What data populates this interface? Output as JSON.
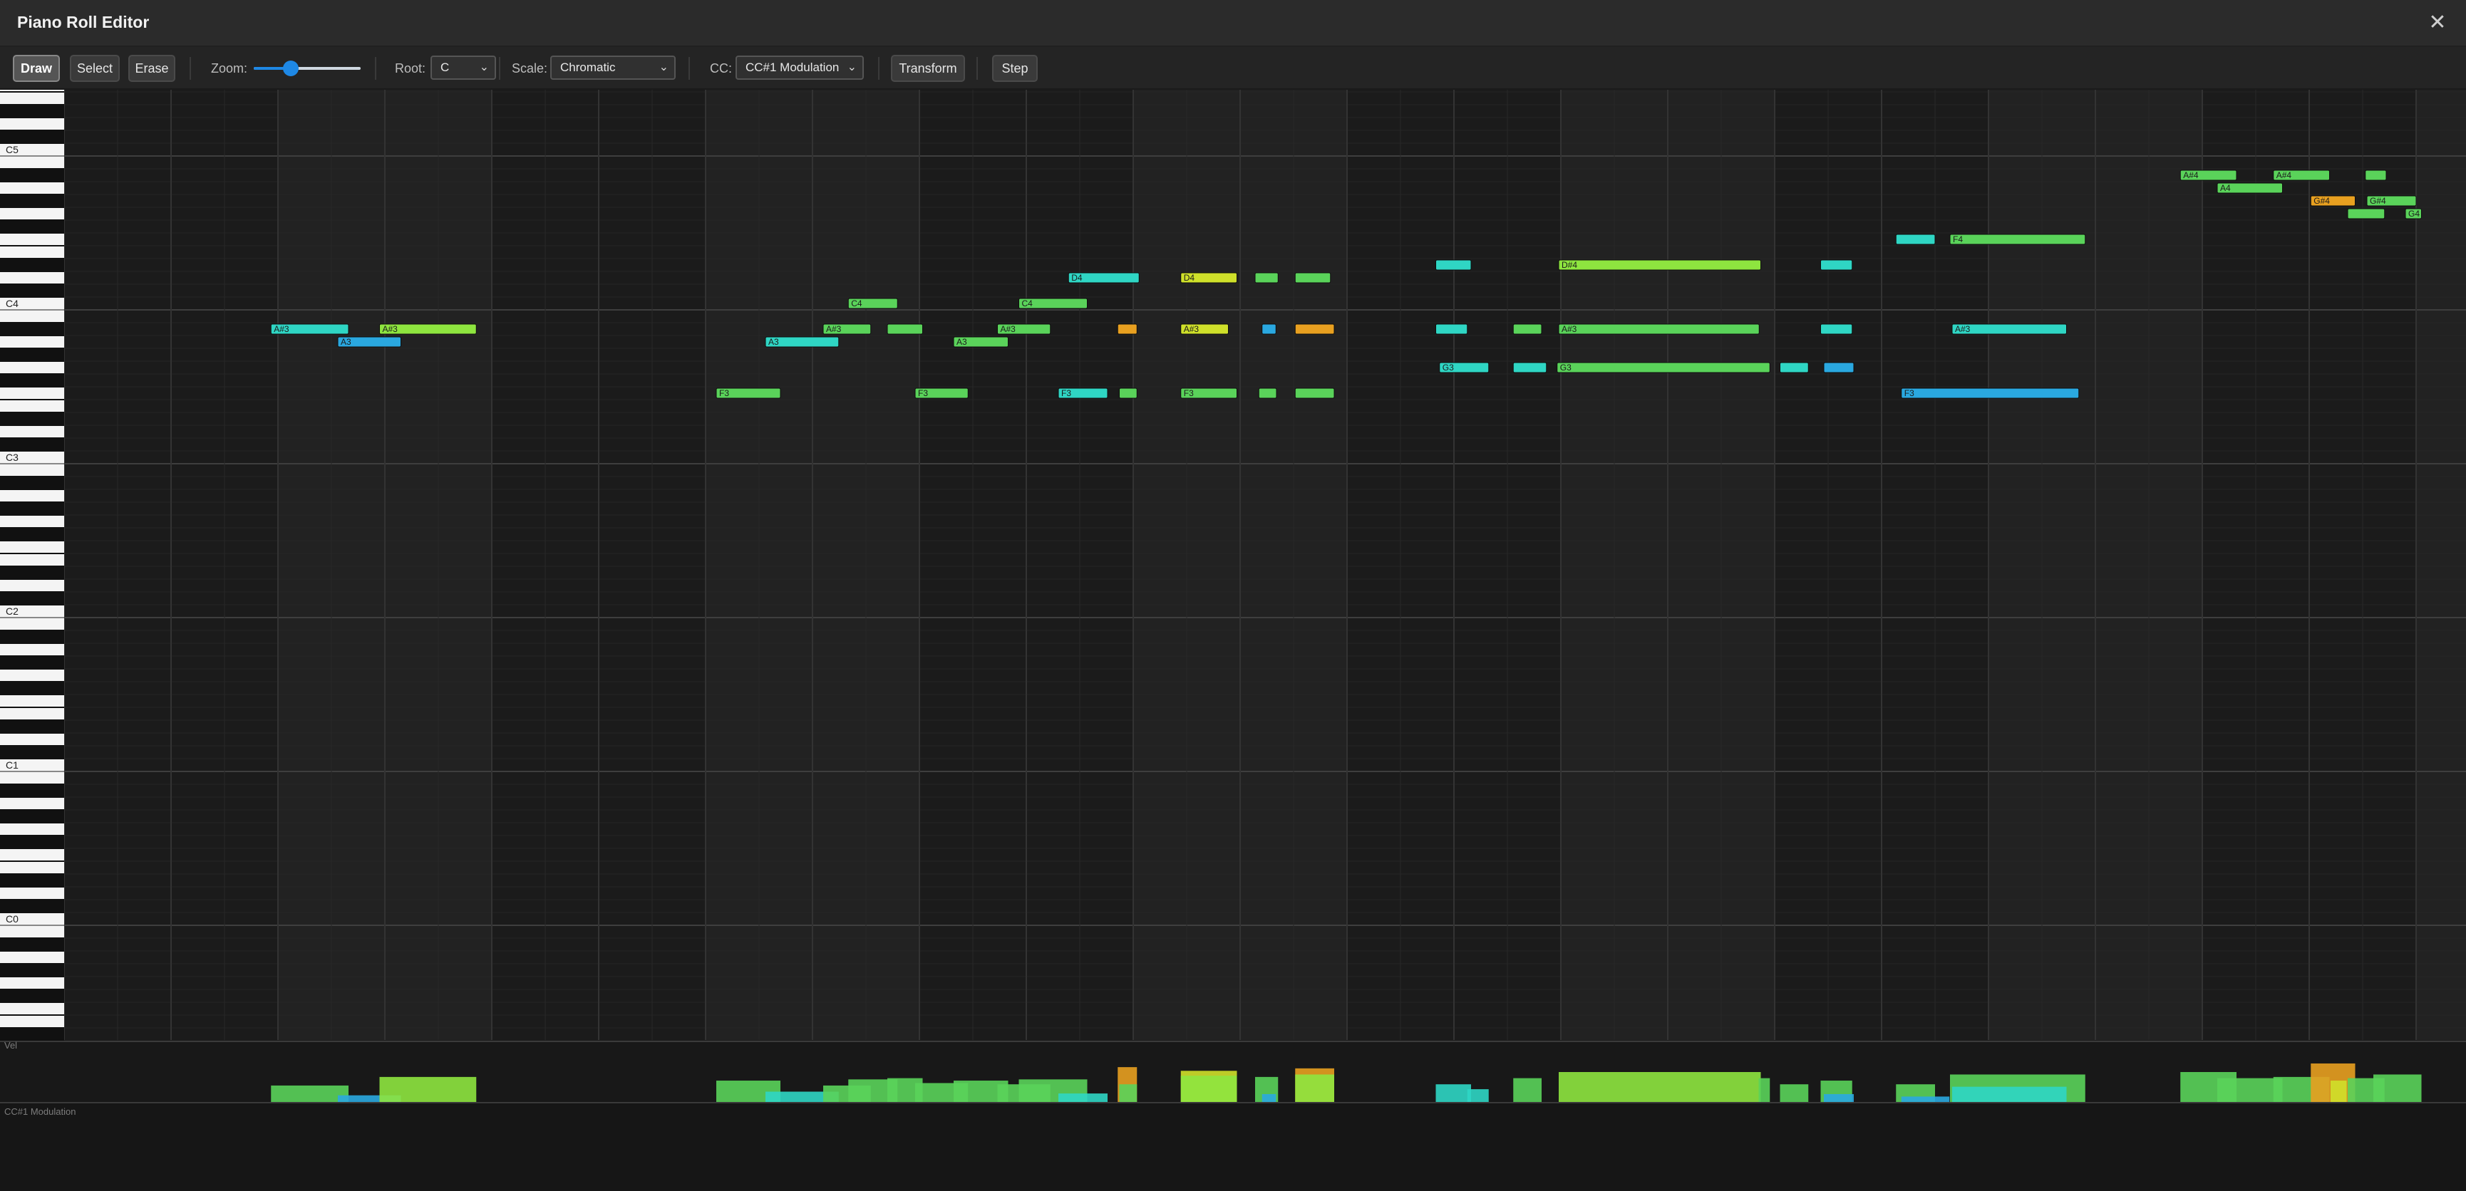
{
  "window": {
    "title": "Piano Roll Editor",
    "close_glyph": "✕"
  },
  "toolbar": {
    "draw_label": "Draw",
    "select_label": "Select",
    "erase_label": "Erase",
    "zoom_label": "Zoom:",
    "zoom_level": 0.35,
    "root_label": "Root:",
    "root_value": "C",
    "scale_label": "Scale:",
    "scale_value": "Chromatic",
    "cc_label": "CC:",
    "cc_value": "CC#1 Modulation",
    "transform_label": "Transform",
    "step_label": "Step"
  },
  "keyboard": {
    "octave_labels": [
      "C5",
      "C4",
      "C3",
      "C2",
      "C1",
      "C0"
    ]
  },
  "lanes": {
    "velocity_label": "Vel",
    "cc_label": "CC#1 Modulation"
  },
  "colors": {
    "green": "#5ad35a",
    "lime": "#8ee53f",
    "yellow": "#cfe02a",
    "orange": "#e8a020",
    "cyan": "#2fd6c4",
    "blue": "#2aa8e0"
  },
  "notes": [
    {
      "name": "A#3",
      "b": 3.87,
      "d": 1.45,
      "c": "cyan",
      "label": "A#3"
    },
    {
      "name": "A3",
      "b": 5.12,
      "d": 1.18,
      "c": "blue",
      "label": "A3"
    },
    {
      "name": "A#3",
      "b": 5.9,
      "d": 1.81,
      "c": "lime",
      "label": "A#3"
    },
    {
      "name": "F3",
      "b": 12.2,
      "d": 1.2,
      "c": "green",
      "label": "F3"
    },
    {
      "name": "A3",
      "b": 13.12,
      "d": 1.37,
      "c": "cyan",
      "label": "A3"
    },
    {
      "name": "A#3",
      "b": 14.2,
      "d": 0.89,
      "c": "green",
      "label": "A#3"
    },
    {
      "name": "C4",
      "b": 14.67,
      "d": 0.92,
      "c": "green",
      "label": "C4"
    },
    {
      "name": "A#3",
      "b": 15.4,
      "d": 0.66,
      "c": "green",
      "label": ""
    },
    {
      "name": "F3",
      "b": 15.92,
      "d": 0.99,
      "c": "green",
      "label": "F3"
    },
    {
      "name": "A3",
      "b": 16.64,
      "d": 1.02,
      "c": "green",
      "label": "A3"
    },
    {
      "name": "A#3",
      "b": 17.46,
      "d": 0.99,
      "c": "green",
      "label": "A#3"
    },
    {
      "name": "C4",
      "b": 17.86,
      "d": 1.28,
      "c": "green",
      "label": "C4"
    },
    {
      "name": "F3",
      "b": 18.6,
      "d": 0.92,
      "c": "cyan",
      "label": "F3"
    },
    {
      "name": "D4",
      "b": 18.79,
      "d": 1.32,
      "c": "cyan",
      "label": "D4"
    },
    {
      "name": "A#3",
      "b": 19.71,
      "d": 0.36,
      "c": "orange",
      "label": ""
    },
    {
      "name": "F3",
      "b": 19.74,
      "d": 0.33,
      "c": "green",
      "label": ""
    },
    {
      "name": "D4",
      "b": 20.89,
      "d": 1.05,
      "c": "yellow",
      "label": "D4"
    },
    {
      "name": "A#3",
      "b": 20.89,
      "d": 0.89,
      "c": "yellow",
      "label": "A#3"
    },
    {
      "name": "F3",
      "b": 20.89,
      "d": 1.05,
      "c": "green",
      "label": "F3"
    },
    {
      "name": "D4",
      "b": 22.28,
      "d": 0.43,
      "c": "green",
      "label": ""
    },
    {
      "name": "A#3",
      "b": 22.41,
      "d": 0.26,
      "c": "blue",
      "label": ""
    },
    {
      "name": "F3",
      "b": 22.35,
      "d": 0.33,
      "c": "green",
      "label": ""
    },
    {
      "name": "D4",
      "b": 23.03,
      "d": 0.66,
      "c": "green",
      "label": ""
    },
    {
      "name": "A#3",
      "b": 23.03,
      "d": 0.73,
      "c": "orange",
      "label": ""
    },
    {
      "name": "F3",
      "b": 23.03,
      "d": 0.73,
      "c": "green",
      "label": ""
    },
    {
      "name": "D#4",
      "b": 25.66,
      "d": 0.66,
      "c": "cyan",
      "label": ""
    },
    {
      "name": "A#3",
      "b": 25.66,
      "d": 0.59,
      "c": "cyan",
      "label": ""
    },
    {
      "name": "G3",
      "b": 25.73,
      "d": 0.92,
      "c": "cyan",
      "label": "G3"
    },
    {
      "name": "A#3",
      "b": 27.11,
      "d": 0.53,
      "c": "green",
      "label": ""
    },
    {
      "name": "G3",
      "b": 27.11,
      "d": 0.62,
      "c": "cyan",
      "label": ""
    },
    {
      "name": "D#4",
      "b": 27.96,
      "d": 3.78,
      "c": "lime",
      "label": "D#4"
    },
    {
      "name": "A#3",
      "b": 27.96,
      "d": 3.75,
      "c": "green",
      "label": "A#3"
    },
    {
      "name": "G3",
      "b": 27.93,
      "d": 3.98,
      "c": "green",
      "label": "G3"
    },
    {
      "name": "G3",
      "b": 32.1,
      "d": 0.53,
      "c": "cyan",
      "label": ""
    },
    {
      "name": "D#4",
      "b": 32.86,
      "d": 0.59,
      "c": "cyan",
      "label": ""
    },
    {
      "name": "A#3",
      "b": 32.86,
      "d": 0.59,
      "c": "cyan",
      "label": ""
    },
    {
      "name": "G3",
      "b": 32.92,
      "d": 0.56,
      "c": "blue",
      "label": ""
    },
    {
      "name": "F4",
      "b": 34.27,
      "d": 0.73,
      "c": "cyan",
      "label": ""
    },
    {
      "name": "F3",
      "b": 34.37,
      "d": 3.32,
      "c": "blue",
      "label": "F3"
    },
    {
      "name": "F4",
      "b": 35.28,
      "d": 2.53,
      "c": "green",
      "label": "F4"
    },
    {
      "name": "A#3",
      "b": 35.32,
      "d": 2.14,
      "c": "cyan",
      "label": "A#3"
    },
    {
      "name": "A#4",
      "b": 39.59,
      "d": 1.05,
      "c": "green",
      "label": "A#4"
    },
    {
      "name": "A4",
      "b": 40.28,
      "d": 1.22,
      "c": "green",
      "label": "A4"
    },
    {
      "name": "A#4",
      "b": 41.33,
      "d": 1.05,
      "c": "green",
      "label": "A#4"
    },
    {
      "name": "G#4",
      "b": 42.03,
      "d": 0.83,
      "c": "orange",
      "label": "G#4"
    },
    {
      "name": "G4",
      "b": 42.72,
      "d": 0.69,
      "c": "green",
      "label": ""
    },
    {
      "name": "A#4",
      "b": 43.05,
      "d": 0.39,
      "c": "green",
      "label": ""
    },
    {
      "name": "G#4",
      "b": 43.08,
      "d": 0.92,
      "c": "green",
      "label": "G#4"
    },
    {
      "name": "G4",
      "b": 43.8,
      "d": 0.3,
      "c": "green",
      "label": "G4"
    }
  ],
  "velocities": [
    {
      "b": 3.87,
      "d": 1.45,
      "v": 0.28,
      "c": "green"
    },
    {
      "b": 5.12,
      "d": 1.18,
      "v": 0.12,
      "c": "blue"
    },
    {
      "b": 5.9,
      "d": 1.81,
      "v": 0.42,
      "c": "lime"
    },
    {
      "b": 12.2,
      "d": 1.2,
      "v": 0.36,
      "c": "green"
    },
    {
      "b": 13.12,
      "d": 1.37,
      "v": 0.18,
      "c": "cyan"
    },
    {
      "b": 14.2,
      "d": 0.89,
      "v": 0.28,
      "c": "green"
    },
    {
      "b": 14.67,
      "d": 0.92,
      "v": 0.38,
      "c": "green"
    },
    {
      "b": 15.4,
      "d": 0.66,
      "v": 0.4,
      "c": "green"
    },
    {
      "b": 15.92,
      "d": 0.99,
      "v": 0.32,
      "c": "green"
    },
    {
      "b": 16.64,
      "d": 1.02,
      "v": 0.36,
      "c": "green"
    },
    {
      "b": 17.46,
      "d": 0.99,
      "v": 0.3,
      "c": "green"
    },
    {
      "b": 17.86,
      "d": 1.28,
      "v": 0.38,
      "c": "green"
    },
    {
      "b": 18.6,
      "d": 0.92,
      "v": 0.15,
      "c": "cyan"
    },
    {
      "b": 19.71,
      "d": 0.36,
      "v": 0.58,
      "c": "orange"
    },
    {
      "b": 19.74,
      "d": 0.33,
      "v": 0.3,
      "c": "green"
    },
    {
      "b": 20.89,
      "d": 1.05,
      "v": 0.52,
      "c": "yellow"
    },
    {
      "b": 20.89,
      "d": 1.05,
      "v": 0.44,
      "c": "lime"
    },
    {
      "b": 22.28,
      "d": 0.43,
      "v": 0.42,
      "c": "green"
    },
    {
      "b": 22.41,
      "d": 0.26,
      "v": 0.14,
      "c": "blue"
    },
    {
      "b": 23.03,
      "d": 0.73,
      "v": 0.56,
      "c": "orange"
    },
    {
      "b": 23.03,
      "d": 0.73,
      "v": 0.46,
      "c": "lime"
    },
    {
      "b": 25.66,
      "d": 0.66,
      "v": 0.3,
      "c": "cyan"
    },
    {
      "b": 26.25,
      "d": 0.4,
      "v": 0.22,
      "c": "cyan"
    },
    {
      "b": 27.11,
      "d": 0.53,
      "v": 0.4,
      "c": "green"
    },
    {
      "b": 27.96,
      "d": 3.78,
      "v": 0.5,
      "c": "lime"
    },
    {
      "b": 31.7,
      "d": 0.21,
      "v": 0.4,
      "c": "green"
    },
    {
      "b": 32.1,
      "d": 0.53,
      "v": 0.3,
      "c": "green"
    },
    {
      "b": 32.86,
      "d": 0.59,
      "v": 0.36,
      "c": "green"
    },
    {
      "b": 32.92,
      "d": 0.56,
      "v": 0.14,
      "c": "blue"
    },
    {
      "b": 34.27,
      "d": 0.73,
      "v": 0.3,
      "c": "green"
    },
    {
      "b": 34.37,
      "d": 0.9,
      "v": 0.1,
      "c": "blue"
    },
    {
      "b": 35.28,
      "d": 2.53,
      "v": 0.46,
      "c": "green"
    },
    {
      "b": 35.32,
      "d": 2.14,
      "v": 0.26,
      "c": "cyan"
    },
    {
      "b": 39.59,
      "d": 1.05,
      "v": 0.5,
      "c": "green"
    },
    {
      "b": 40.28,
      "d": 1.22,
      "v": 0.4,
      "c": "green"
    },
    {
      "b": 41.33,
      "d": 1.05,
      "v": 0.42,
      "c": "green"
    },
    {
      "b": 42.03,
      "d": 0.83,
      "v": 0.64,
      "c": "orange"
    },
    {
      "b": 42.4,
      "d": 0.3,
      "v": 0.36,
      "c": "yellow"
    },
    {
      "b": 42.72,
      "d": 0.69,
      "v": 0.4,
      "c": "green"
    },
    {
      "b": 43.2,
      "d": 0.9,
      "v": 0.46,
      "c": "green"
    }
  ]
}
